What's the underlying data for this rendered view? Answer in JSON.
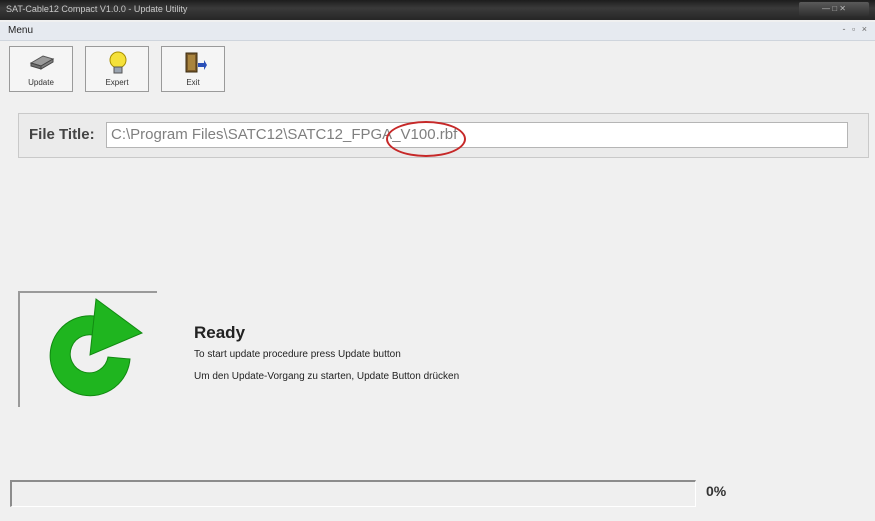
{
  "window": {
    "title": "SAT-Cable12 Compact V1.0.0 - Update Utility",
    "controls": "— □ ✕"
  },
  "menubar": {
    "menu_label": "Menu",
    "mdi_controls": "- ▫ ×"
  },
  "toolbar": {
    "update_label": "Update",
    "expert_label": "Expert",
    "exit_label": "Exit"
  },
  "file": {
    "label": "File Title:",
    "value": "C:\\Program Files\\SATC12\\SATC12_FPGA_V100.rbf"
  },
  "status": {
    "title": "Ready",
    "line_en": "To start update procedure press Update button",
    "line_de": "Um den Update-Vorgang zu starten, Update Button drücken"
  },
  "progress": {
    "value": 0,
    "text": "0%"
  },
  "colors": {
    "refresh_arrow": "#1fb51f",
    "annotation_circle": "#c62828"
  }
}
